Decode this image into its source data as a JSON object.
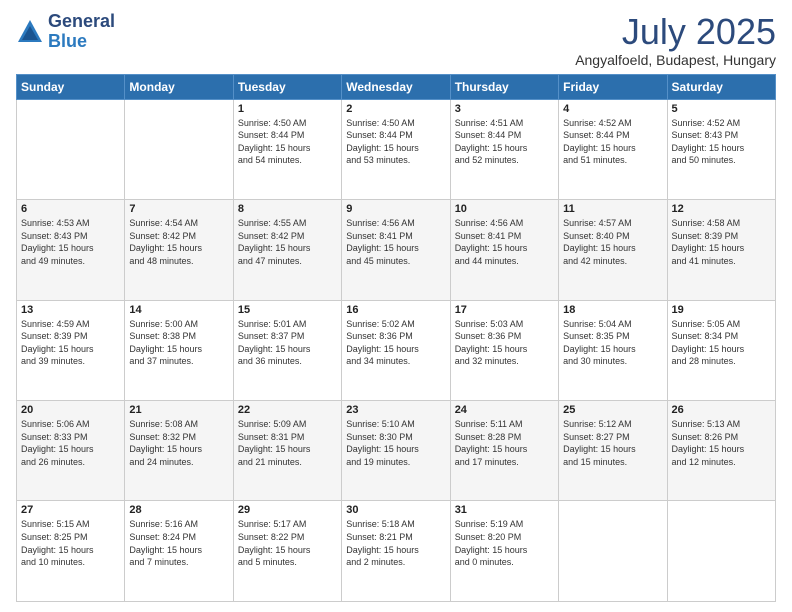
{
  "header": {
    "logo_general": "General",
    "logo_blue": "Blue",
    "month": "July 2025",
    "location": "Angyalfoeld, Budapest, Hungary"
  },
  "days_of_week": [
    "Sunday",
    "Monday",
    "Tuesday",
    "Wednesday",
    "Thursday",
    "Friday",
    "Saturday"
  ],
  "weeks": [
    [
      null,
      null,
      {
        "day": "1",
        "sunrise": "4:50 AM",
        "sunset": "8:44 PM",
        "daylight": "15 hours and 54 minutes."
      },
      {
        "day": "2",
        "sunrise": "4:50 AM",
        "sunset": "8:44 PM",
        "daylight": "15 hours and 53 minutes."
      },
      {
        "day": "3",
        "sunrise": "4:51 AM",
        "sunset": "8:44 PM",
        "daylight": "15 hours and 52 minutes."
      },
      {
        "day": "4",
        "sunrise": "4:52 AM",
        "sunset": "8:44 PM",
        "daylight": "15 hours and 51 minutes."
      },
      {
        "day": "5",
        "sunrise": "4:52 AM",
        "sunset": "8:43 PM",
        "daylight": "15 hours and 50 minutes."
      }
    ],
    [
      {
        "day": "6",
        "sunrise": "4:53 AM",
        "sunset": "8:43 PM",
        "daylight": "15 hours and 49 minutes."
      },
      {
        "day": "7",
        "sunrise": "4:54 AM",
        "sunset": "8:42 PM",
        "daylight": "15 hours and 48 minutes."
      },
      {
        "day": "8",
        "sunrise": "4:55 AM",
        "sunset": "8:42 PM",
        "daylight": "15 hours and 47 minutes."
      },
      {
        "day": "9",
        "sunrise": "4:56 AM",
        "sunset": "8:41 PM",
        "daylight": "15 hours and 45 minutes."
      },
      {
        "day": "10",
        "sunrise": "4:56 AM",
        "sunset": "8:41 PM",
        "daylight": "15 hours and 44 minutes."
      },
      {
        "day": "11",
        "sunrise": "4:57 AM",
        "sunset": "8:40 PM",
        "daylight": "15 hours and 42 minutes."
      },
      {
        "day": "12",
        "sunrise": "4:58 AM",
        "sunset": "8:39 PM",
        "daylight": "15 hours and 41 minutes."
      }
    ],
    [
      {
        "day": "13",
        "sunrise": "4:59 AM",
        "sunset": "8:39 PM",
        "daylight": "15 hours and 39 minutes."
      },
      {
        "day": "14",
        "sunrise": "5:00 AM",
        "sunset": "8:38 PM",
        "daylight": "15 hours and 37 minutes."
      },
      {
        "day": "15",
        "sunrise": "5:01 AM",
        "sunset": "8:37 PM",
        "daylight": "15 hours and 36 minutes."
      },
      {
        "day": "16",
        "sunrise": "5:02 AM",
        "sunset": "8:36 PM",
        "daylight": "15 hours and 34 minutes."
      },
      {
        "day": "17",
        "sunrise": "5:03 AM",
        "sunset": "8:36 PM",
        "daylight": "15 hours and 32 minutes."
      },
      {
        "day": "18",
        "sunrise": "5:04 AM",
        "sunset": "8:35 PM",
        "daylight": "15 hours and 30 minutes."
      },
      {
        "day": "19",
        "sunrise": "5:05 AM",
        "sunset": "8:34 PM",
        "daylight": "15 hours and 28 minutes."
      }
    ],
    [
      {
        "day": "20",
        "sunrise": "5:06 AM",
        "sunset": "8:33 PM",
        "daylight": "15 hours and 26 minutes."
      },
      {
        "day": "21",
        "sunrise": "5:08 AM",
        "sunset": "8:32 PM",
        "daylight": "15 hours and 24 minutes."
      },
      {
        "day": "22",
        "sunrise": "5:09 AM",
        "sunset": "8:31 PM",
        "daylight": "15 hours and 21 minutes."
      },
      {
        "day": "23",
        "sunrise": "5:10 AM",
        "sunset": "8:30 PM",
        "daylight": "15 hours and 19 minutes."
      },
      {
        "day": "24",
        "sunrise": "5:11 AM",
        "sunset": "8:28 PM",
        "daylight": "15 hours and 17 minutes."
      },
      {
        "day": "25",
        "sunrise": "5:12 AM",
        "sunset": "8:27 PM",
        "daylight": "15 hours and 15 minutes."
      },
      {
        "day": "26",
        "sunrise": "5:13 AM",
        "sunset": "8:26 PM",
        "daylight": "15 hours and 12 minutes."
      }
    ],
    [
      {
        "day": "27",
        "sunrise": "5:15 AM",
        "sunset": "8:25 PM",
        "daylight": "15 hours and 10 minutes."
      },
      {
        "day": "28",
        "sunrise": "5:16 AM",
        "sunset": "8:24 PM",
        "daylight": "15 hours and 7 minutes."
      },
      {
        "day": "29",
        "sunrise": "5:17 AM",
        "sunset": "8:22 PM",
        "daylight": "15 hours and 5 minutes."
      },
      {
        "day": "30",
        "sunrise": "5:18 AM",
        "sunset": "8:21 PM",
        "daylight": "15 hours and 2 minutes."
      },
      {
        "day": "31",
        "sunrise": "5:19 AM",
        "sunset": "8:20 PM",
        "daylight": "15 hours and 0 minutes."
      },
      null,
      null
    ]
  ]
}
